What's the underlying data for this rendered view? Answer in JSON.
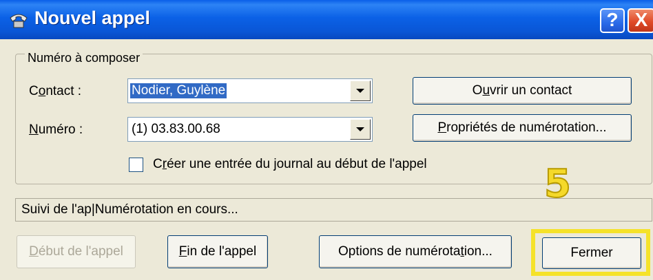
{
  "window": {
    "title": "Nouvel appel"
  },
  "titlebar": {
    "help_label": "?",
    "close_label": "X"
  },
  "group": {
    "legend": "Numéro à composer",
    "contact_label_u": "o",
    "contact_label_pre": "C",
    "contact_label_post": "ntact :",
    "contact_value": "Nodier, Guylène",
    "number_label_u": "N",
    "number_label_post": "uméro :",
    "number_value": "(1) 03.83.00.68",
    "open_contact_pre": "O",
    "open_contact_u": "u",
    "open_contact_post": "vrir un contact",
    "dialing_props_u": "P",
    "dialing_props_post": "ropriétés de numérotation...",
    "journal_checkbox_pre": "C",
    "journal_checkbox_u": "r",
    "journal_checkbox_post": "éer une entrée du journal au début de l'appel",
    "journal_checked": false
  },
  "status": {
    "text": "Suivi de l'ap|Numérotation en cours..."
  },
  "buttons": {
    "start_call_u": "D",
    "start_call_post": "ébut de l'appel",
    "end_call_u": "F",
    "end_call_post": "in de l'appel",
    "dial_options_pre": "Options de numérota",
    "dial_options_u": "t",
    "dial_options_post": "ion...",
    "close": "Fermer"
  },
  "annotation": {
    "step_number": "5",
    "color": "#F5E22A"
  }
}
